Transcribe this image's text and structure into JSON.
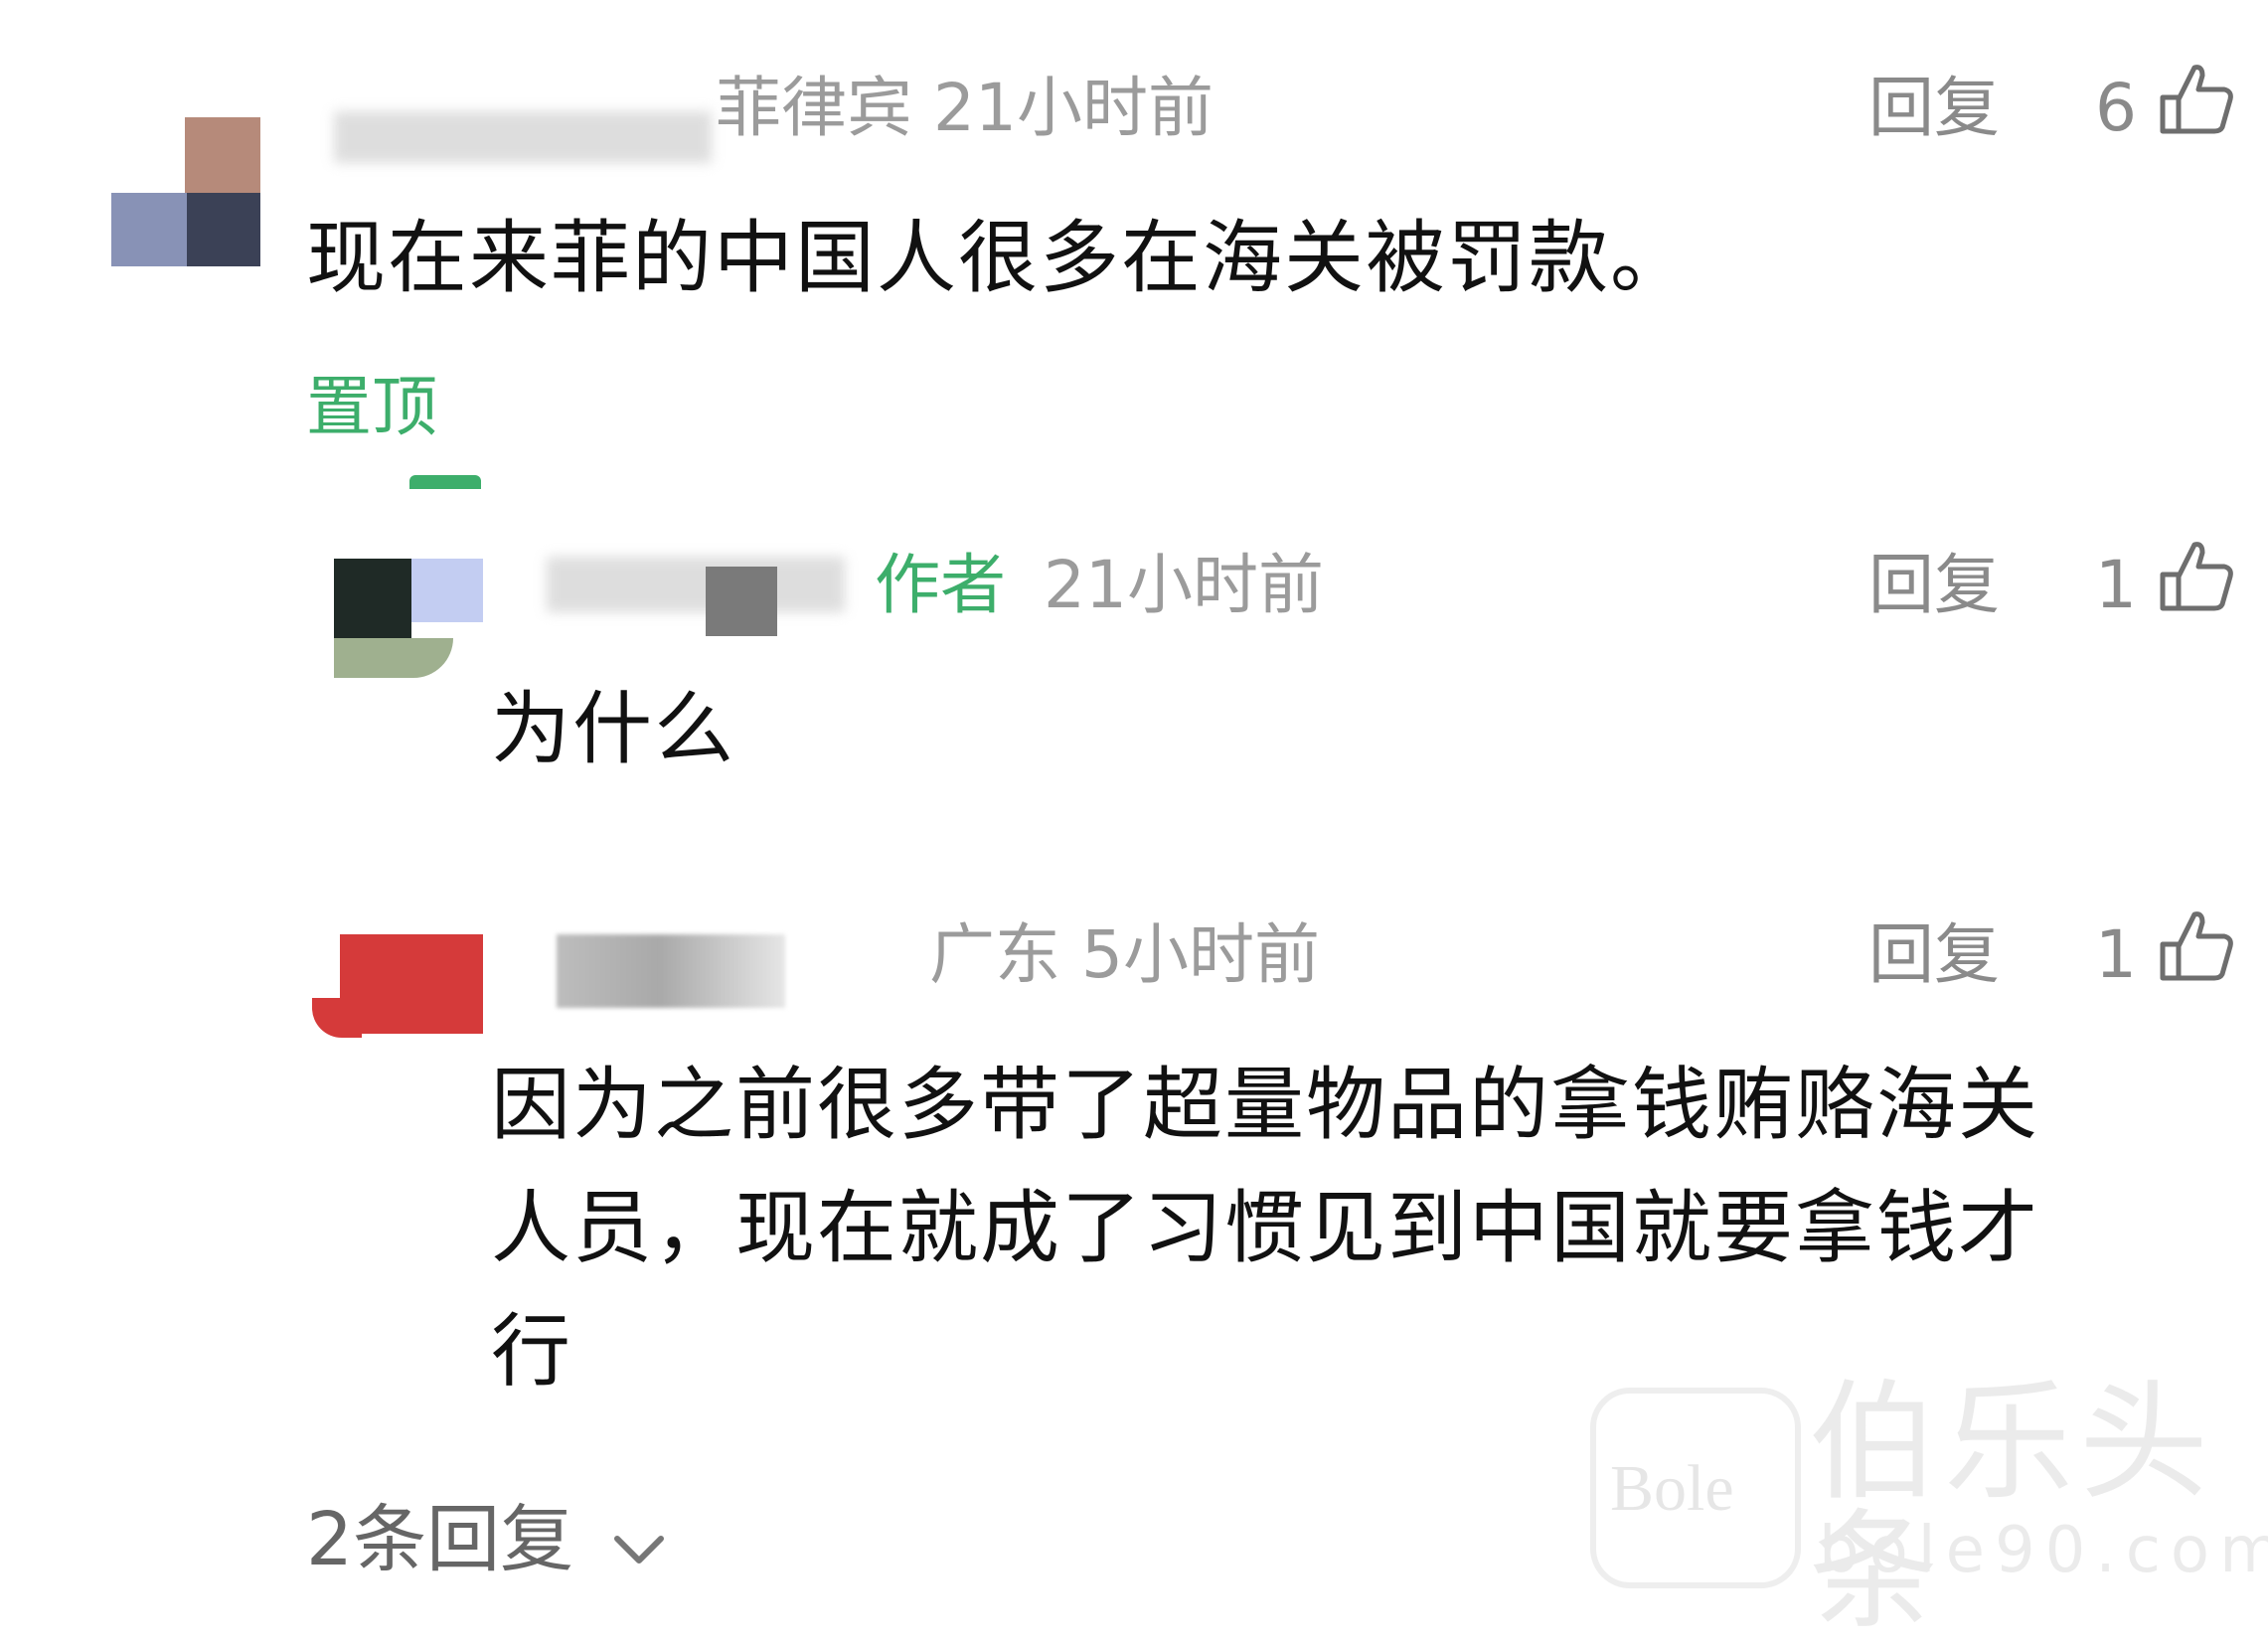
{
  "comments": [
    {
      "meta_suffix": "菲律宾 21小时前",
      "reply_label": "回复",
      "likes": "6",
      "text": "现在来菲的中国人很多在海关被罚款。",
      "pin_label": "置顶"
    },
    {
      "author_tag": "作者",
      "time": "21小时前",
      "reply_label": "回复",
      "likes": "1",
      "text": "为什么"
    },
    {
      "meta_suffix": "广东 5小时前",
      "reply_label": "回复",
      "likes": "1",
      "text_lines": [
        "因为之前很多带了超量物品的拿钱贿赂海关",
        "人员，现在就成了习惯见到中国就要拿钱才",
        "行"
      ]
    }
  ],
  "footer": {
    "more_replies_label": "2条回复"
  },
  "watermark": {
    "name": "伯乐头条",
    "url": "bole90.com",
    "badge": "Bole"
  },
  "colors": {
    "accent_green": "#3dae6b",
    "meta_gray": "#9b9b9b",
    "text": "#111111"
  },
  "icons": [
    "thumbs-up-icon",
    "chevron-down-icon"
  ]
}
